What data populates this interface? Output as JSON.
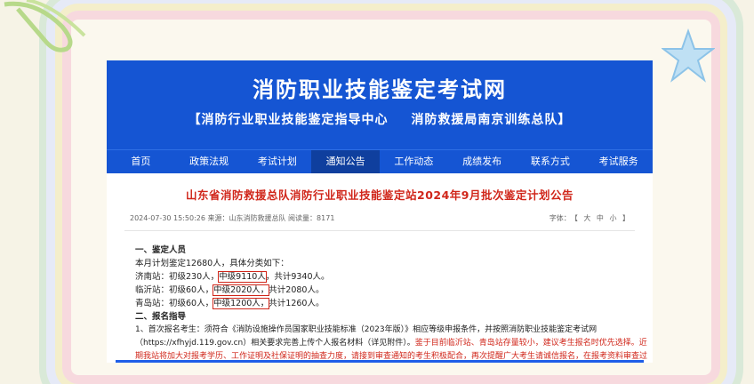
{
  "site": {
    "title": "消防职业技能鉴定考试网",
    "subtitle_left": "【消防行业职业技能鉴定指导中心",
    "subtitle_right": "消防救援局南京训练总队】"
  },
  "nav": {
    "items": [
      {
        "label": "首页"
      },
      {
        "label": "政策法规"
      },
      {
        "label": "考试计划"
      },
      {
        "label": "通知公告"
      },
      {
        "label": "工作动态"
      },
      {
        "label": "成绩发布"
      },
      {
        "label": "联系方式"
      },
      {
        "label": "考试服务"
      }
    ],
    "active_index": 3
  },
  "article": {
    "title": "山东省消防救援总队消防行业职业技能鉴定站2024年9月批次鉴定计划公告",
    "meta": "2024-07-30 15:50:26  来源：山东消防救援总队 阅读量：8171",
    "font_label": "字体：",
    "font_open": "【",
    "font_large": "大",
    "font_mid": "中",
    "font_small": "小",
    "font_close": "】",
    "sec1_title": "一、鉴定人员",
    "sec1_intro": "本月计划鉴定12680人，具体分类如下：",
    "stations": [
      {
        "name": "济南站：",
        "junior": "初级230人，",
        "mid": "中级9110人",
        "total": "，共计9340人。"
      },
      {
        "name": "临沂站：",
        "junior": "初级60人，",
        "mid": "中级2020人，",
        "total": "共计2080人。"
      },
      {
        "name": "青岛站：",
        "junior": "初级60人，",
        "mid": "中级1200人，",
        "total": "共计1260人。"
      }
    ],
    "sec2_title": "二、报名指导",
    "sec2_p1": "1、首次报名考生：须符合《消防设施操作员国家职业技能标准（2023年版）》相应等级申报条件，并按照消防职业技能鉴定考试网",
    "sec2_p2_black": "（https://xfhyjd.119.gov.cn）相关要求完善上传个人报名材料（详见附件）。",
    "sec2_p2_red": "鉴于目前临沂站、青岛站存量较小，建议考生报名时优先选择。近",
    "sec2_p3_red": "期我站将加大对报考学历、工作证明及社保证明的抽查力度，请接到审查通知的考生积极配合，再次提醒广大考生请诚信报名，在报考资料审查过"
  },
  "colors": {
    "header_blue": "#1555d3",
    "nav_active": "#0f3f9e",
    "title_red": "#d0261a"
  }
}
